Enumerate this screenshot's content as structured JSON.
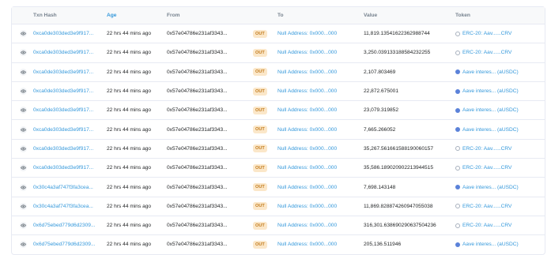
{
  "header": {
    "eye": "",
    "hash": "Txn Hash",
    "age": "Age",
    "from": "From",
    "to": "To",
    "value": "Value",
    "token": "Token"
  },
  "rows": [
    {
      "hash": "0xca0de303ded3e9f917...",
      "age": "22 hrs 44 mins ago",
      "from": "0x57e04786e231af3343...",
      "dir": "OUT",
      "to": "Null Address: 0x000...000",
      "value": "11,819.13541622362988744",
      "token": "ERC-20: Aav......CRV",
      "token_icon": "generic-token-icon"
    },
    {
      "hash": "0xca0de303ded3e9f917...",
      "age": "22 hrs 44 mins ago",
      "from": "0x57e04786e231af3343...",
      "dir": "OUT",
      "to": "Null Address: 0x000...000",
      "value": "3,250.039133188584232255",
      "token": "ERC-20: Aav......CRV",
      "token_icon": "generic-token-icon"
    },
    {
      "hash": "0xca0de303ded3e9f917...",
      "age": "22 hrs 44 mins ago",
      "from": "0x57e04786e231af3343...",
      "dir": "OUT",
      "to": "Null Address: 0x000...000",
      "value": "2,107.803469",
      "token": "Aave interes... (aUSDC)",
      "token_icon": "aave-token-icon"
    },
    {
      "hash": "0xca0de303ded3e9f917...",
      "age": "22 hrs 44 mins ago",
      "from": "0x57e04786e231af3343...",
      "dir": "OUT",
      "to": "Null Address: 0x000...000",
      "value": "22,872.675001",
      "token": "Aave interes... (aUSDC)",
      "token_icon": "aave-token-icon"
    },
    {
      "hash": "0xca0de303ded3e9f917...",
      "age": "22 hrs 44 mins ago",
      "from": "0x57e04786e231af3343...",
      "dir": "OUT",
      "to": "Null Address: 0x000...000",
      "value": "23,079.319852",
      "token": "Aave interes... (aUSDC)",
      "token_icon": "aave-token-icon"
    },
    {
      "hash": "0xca0de303ded3e9f917...",
      "age": "22 hrs 44 mins ago",
      "from": "0x57e04786e231af3343...",
      "dir": "OUT",
      "to": "Null Address: 0x000...000",
      "value": "7,665.266052",
      "token": "Aave interes... (aUSDC)",
      "token_icon": "aave-token-icon"
    },
    {
      "hash": "0xca0de303ded3e9f917...",
      "age": "22 hrs 44 mins ago",
      "from": "0x57e04786e231af3343...",
      "dir": "OUT",
      "to": "Null Address: 0x000...000",
      "value": "35,267.561661588190060157",
      "token": "ERC-20: Aav......CRV",
      "token_icon": "generic-token-icon"
    },
    {
      "hash": "0xca0de303ded3e9f917...",
      "age": "22 hrs 44 mins ago",
      "from": "0x57e04786e231af3343...",
      "dir": "OUT",
      "to": "Null Address: 0x000...000",
      "value": "35,586.189020902213944515",
      "token": "ERC-20: Aav......CRV",
      "token_icon": "generic-token-icon"
    },
    {
      "hash": "0x30c4a3af747f3fa3cea...",
      "age": "22 hrs 44 mins ago",
      "from": "0x57e04786e231af3343...",
      "dir": "OUT",
      "to": "Null Address: 0x000...000",
      "value": "7,698.143148",
      "token": "Aave interes... (aUSDC)",
      "token_icon": "aave-token-icon"
    },
    {
      "hash": "0x30c4a3af747f3fa3cea...",
      "age": "22 hrs 44 mins ago",
      "from": "0x57e04786e231af3343...",
      "dir": "OUT",
      "to": "Null Address: 0x000...000",
      "value": "11,869.828874260947055038",
      "token": "ERC-20: Aav......CRV",
      "token_icon": "generic-token-icon"
    },
    {
      "hash": "0x6d75ebed779d6d2309...",
      "age": "22 hrs 44 mins ago",
      "from": "0x57e04786e231af3343...",
      "dir": "OUT",
      "to": "Null Address: 0x000...000",
      "value": "316,301.638690290637504236",
      "token": "ERC-20: Aav......CRV",
      "token_icon": "generic-token-icon"
    },
    {
      "hash": "0x6d75ebed779d6d2309...",
      "age": "22 hrs 44 mins ago",
      "from": "0x57e04786e231af3343...",
      "dir": "OUT",
      "to": "Null Address: 0x000...000",
      "value": "205,136.511946",
      "token": "Aave interes... (aUSDC)",
      "token_icon": "aave-token-icon"
    }
  ],
  "colors": {
    "link": "#3498db",
    "out_badge_bg": "#fbe7c9",
    "out_badge_text": "#c27b1c",
    "aave_icon": "#5b82d9"
  }
}
